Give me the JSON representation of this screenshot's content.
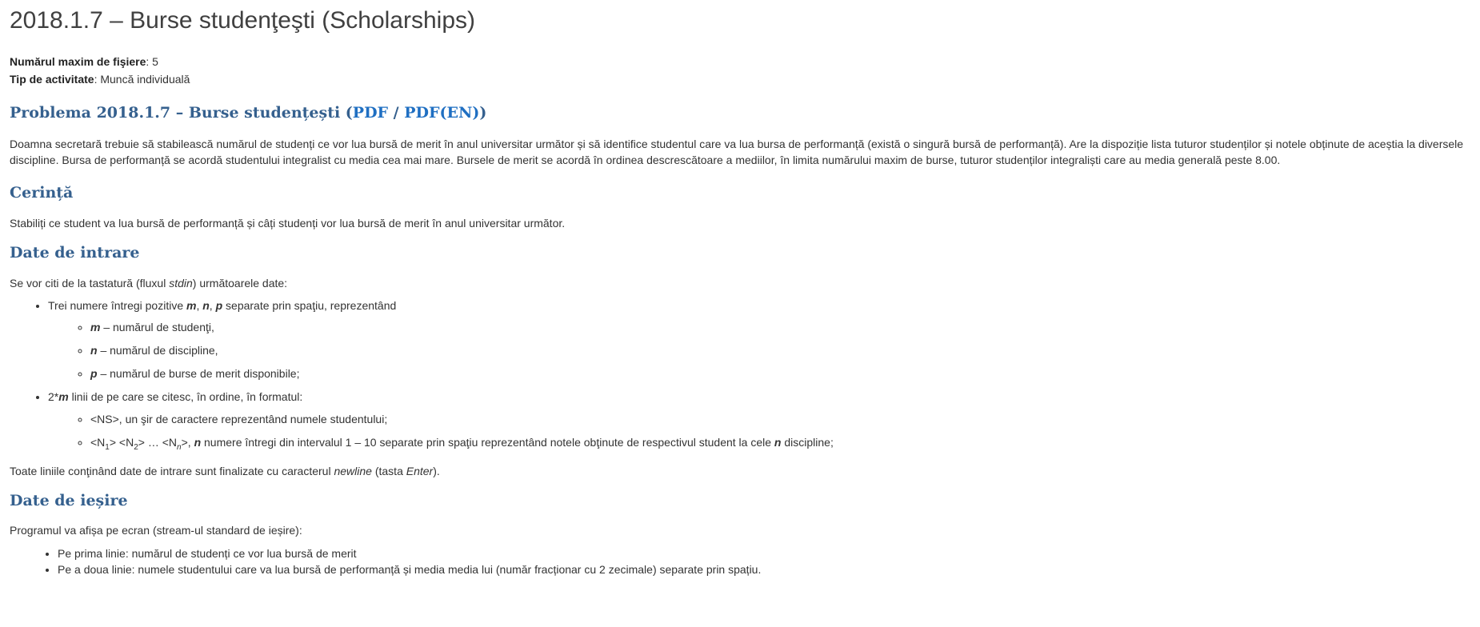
{
  "title": "2018.1.7 – Burse studenţeşti (Scholarships)",
  "meta": {
    "max_files_label": "Numărul maxim de fişiere",
    "max_files_value": ": 5",
    "activity_label": "Tip de activitate",
    "activity_value": ": Muncă individuală"
  },
  "problem": {
    "prefix": "Problema 2018.1.7 – Burse studențești (",
    "link_pdf": "PDF",
    "sep": " / ",
    "link_pdf_en": "PDF(EN)",
    "suffix": ")"
  },
  "description": "Doamna secretară trebuie să stabilească numărul de studenți ce vor lua bursă de merit în anul universitar următor și să identifice studentul care va lua bursa de performanță (există o singură bursă de performanță). Are la dispoziție lista tuturor studenților și notele obținute de aceștia la diversele discipline. Bursa de performanță se acordă studentului integralist cu media cea mai mare. Bursele de merit se acordă în ordinea descrescătoare a mediilor, în limita numărului maxim de burse, tuturor studenților integraliști care au media generală peste 8.00.",
  "cerinta": {
    "heading": "Cerință",
    "text": "Stabiliți ce student va lua bursă de performanță și câți studenți vor lua bursă de merit în anul universitar următor."
  },
  "input": {
    "heading": "Date de intrare",
    "intro_a": "Se vor citi de la tastatură (fluxul ",
    "intro_stdin": "stdin",
    "intro_b": ") următoarele date:",
    "item1_a": "Trei numere întregi pozitive ",
    "m": "m",
    "comma": ", ",
    "n": "n",
    "p": "p",
    "item1_b": " separate prin spaţiu, reprezentând",
    "sub_m": " – numărul de studenţi,",
    "sub_n": " – numărul de discipline,",
    "sub_p": " – numărul de burse de merit disponibile;",
    "item2_a": "2*",
    "item2_b": " linii de pe care se citesc, în ordine, în formatul:",
    "ns_line": "<NS>, un şir de caractere reprezentând numele studentului;",
    "n_line_a": "<N",
    "sub1": "1",
    "n_line_b": ">  <N",
    "sub2": "2",
    "n_line_c": ">  …  <N",
    "subn": "n",
    "n_line_d": ">, ",
    "n_line_e": " numere întregi din intervalul 1 – 10 separate prin spaţiu reprezentând notele obţinute de respectivul student la cele ",
    "n_line_f": " discipline;",
    "newline_a": "Toate liniile conţinând date de intrare sunt finalizate cu caracterul ",
    "newline_word": "newline",
    "newline_b": " (tasta ",
    "enter_word": "Enter",
    "newline_c": ")."
  },
  "output": {
    "heading": "Date de ieșire",
    "intro": "Programul va afișa pe ecran (stream-ul standard de ieșire):",
    "line1": "Pe prima linie: numărul de studenți ce vor lua bursă de merit",
    "line2": "Pe a doua linie: numele studentului care va lua bursă de performanță și media media lui (număr fracționar cu 2 zecimale) separate prin spațiu."
  }
}
